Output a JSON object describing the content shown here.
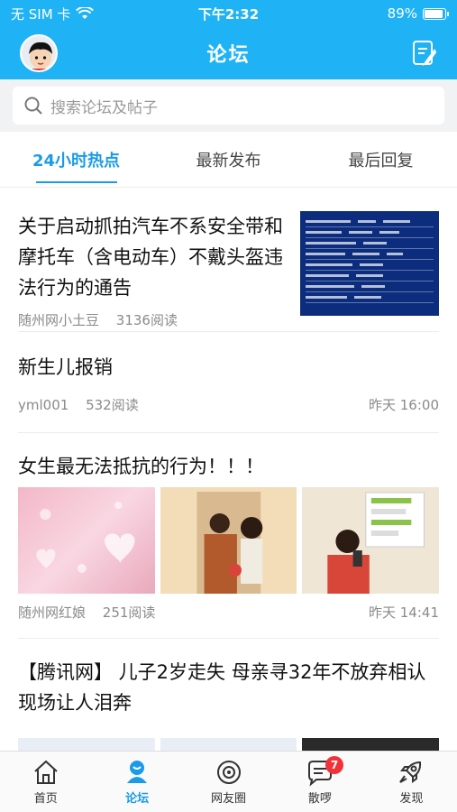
{
  "status_bar": {
    "carrier": "无 SIM 卡",
    "time": "下午2:32",
    "battery": "89%",
    "battery_level": 0.89
  },
  "header": {
    "title": "论坛"
  },
  "search": {
    "placeholder": "搜索论坛及帖子"
  },
  "tabs": [
    {
      "label": "24小时热点",
      "active": true
    },
    {
      "label": "最新发布",
      "active": false
    },
    {
      "label": "最后回复",
      "active": false
    }
  ],
  "posts": [
    {
      "title": "关于启动抓拍汽车不系安全带和摩托车（含电动车）不戴头盔违法行为的通告",
      "author": "随州网小土豆",
      "reads": "3136阅读",
      "time": ""
    },
    {
      "title": "新生儿报销",
      "author": "yml001",
      "reads": "532阅读",
      "time": "昨天 16:00"
    },
    {
      "title": "女生最无法抵抗的行为！！！",
      "author": "随州网红娘",
      "reads": "251阅读",
      "time": "昨天 14:41"
    },
    {
      "title": "【腾讯网】 儿子2岁走失 母亲寻32年不放弃相认现场让人泪奔"
    }
  ],
  "tabbar": [
    {
      "label": "首页",
      "icon": "home-icon",
      "active": false
    },
    {
      "label": "论坛",
      "icon": "forum-icon",
      "active": true
    },
    {
      "label": "网友圈",
      "icon": "circle-icon",
      "active": false
    },
    {
      "label": "散啰",
      "icon": "chat-icon",
      "active": false,
      "badge": "7"
    },
    {
      "label": "发现",
      "icon": "rocket-icon",
      "active": false
    }
  ],
  "colors": {
    "brand": "#1fb3f5",
    "active": "#1a9be8",
    "badge": "#f0333a"
  }
}
